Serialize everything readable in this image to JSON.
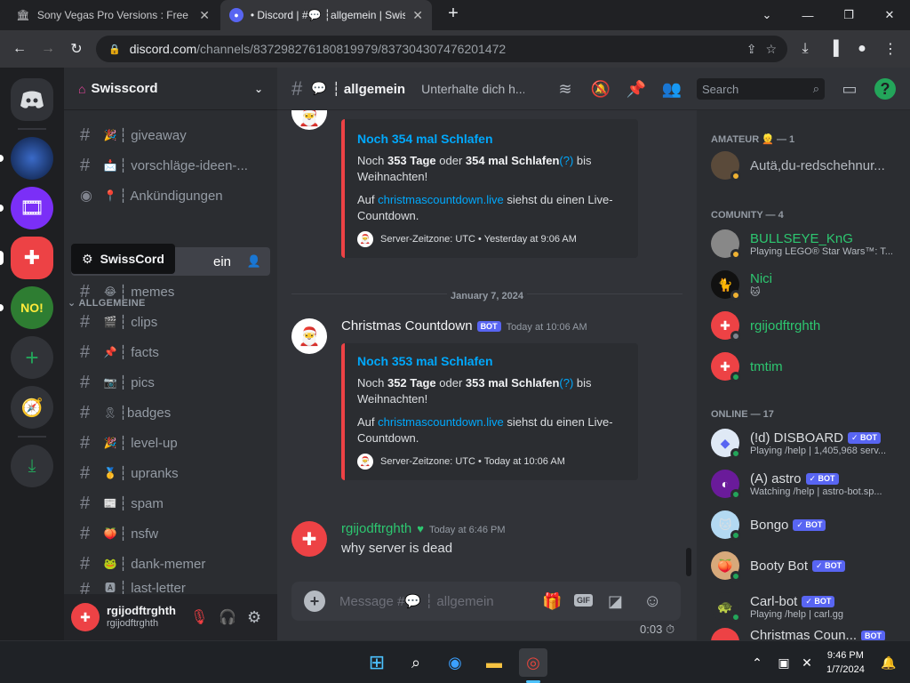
{
  "browser": {
    "tabs": [
      {
        "title": "Sony Vegas Pro Versions : Free D",
        "close": "✕"
      },
      {
        "title": "• Discord | #💬 ┆allgemein | Swis",
        "close": "✕"
      }
    ],
    "new_tab": "+",
    "url_host": "discord.com",
    "url_path": "/channels/837298276180819979/837304307476201472"
  },
  "server": {
    "name": "Swisscord",
    "tooltip": "SwissCord",
    "category": "ALLGEMEINE",
    "channels_top": [
      {
        "emoji": "🎉",
        "label": "┆ giveaway"
      },
      {
        "emoji": "📩",
        "label": "┆ vorschläge-ideen-..."
      },
      {
        "emoji": "📍",
        "label": "┆ Ankündigungen"
      }
    ],
    "selected_channel_label": "ein",
    "channels": [
      {
        "emoji": "😂",
        "label": "┆ memes"
      },
      {
        "emoji": "🎬",
        "label": "┆ clips"
      },
      {
        "emoji": "📌",
        "label": "┆ facts"
      },
      {
        "emoji": "📷",
        "label": "┆ pics"
      },
      {
        "emoji": "🎗",
        "label": "┆badges"
      },
      {
        "emoji": "🎉",
        "label": "┆ level-up"
      },
      {
        "emoji": "🥇",
        "label": "┆ upranks"
      },
      {
        "emoji": "📰",
        "label": "┆ spam"
      },
      {
        "emoji": "🍑",
        "label": "┆ nsfw"
      },
      {
        "emoji": "🐸",
        "label": "┆ dank-memer"
      },
      {
        "emoji": "🅰",
        "label": "┆ last-letter"
      }
    ]
  },
  "user": {
    "display": "rgijodftrghth",
    "username": "rgijodftrghth"
  },
  "chat": {
    "channel": "┆ allgemein",
    "topic": "Unterhalte dich h...",
    "search_placeholder": "Search",
    "embed1": {
      "title": "Noch 354 mal Schlafen",
      "line_pre": "Noch ",
      "days": "353 Tage",
      "mid": " oder ",
      "sleeps": "354 mal Schlafen",
      "q": "(?)",
      "post": " bis Weihnachten!",
      "auf": "Auf ",
      "link": "christmascountdown.live",
      "rest": " siehst du einen Live-Countdown.",
      "footer": "Server-Zeitzone: UTC • Yesterday at 9:06 AM"
    },
    "date_divider": "January 7, 2024",
    "msg2": {
      "author": "Christmas Countdown",
      "bot": "BOT",
      "time": "Today at 10:06 AM"
    },
    "embed2": {
      "title": "Noch 353 mal Schlafen",
      "line_pre": "Noch ",
      "days": "352 Tage",
      "mid": " oder ",
      "sleeps": "353 mal Schlafen",
      "q": "(?)",
      "post": " bis Weihnachten!",
      "auf": "Auf ",
      "link": "christmascountdown.live",
      "rest": " siehst du einen Live-Countdown.",
      "footer": "Server-Zeitzone: UTC • Today at 10:06 AM"
    },
    "msg3": {
      "author": "rgijodftrghth",
      "time": "Today at 6:46 PM",
      "text": "why server is dead"
    },
    "composer_placeholder": "Message #💬 ┆ allgemein",
    "timer": "0:03"
  },
  "members": {
    "cat_amateur": "AMATEUR 👱 — 1",
    "cat_comunity": "COMUNITY — 4",
    "cat_online": "ONLINE — 17",
    "list": [
      {
        "name": "Autä,du-redschehnur...",
        "status": "",
        "color": "#b5bac1",
        "bot": ""
      },
      {
        "name": "BULLSEYE_KnG",
        "status": "Playing LEGO® Star Wars™: T...",
        "color": "#2dc770",
        "bot": ""
      },
      {
        "name": "Nici",
        "status": "🐱",
        "color": "#2dc770",
        "bot": ""
      },
      {
        "name": "rgijodftrghth",
        "status": "",
        "color": "#2dc770",
        "bot": ""
      },
      {
        "name": "tmtim",
        "status": "",
        "color": "#2dc770",
        "bot": ""
      },
      {
        "name": "(!d) DISBOARD",
        "status": "Playing /help | 1,405,968 serv...",
        "color": "#f2f3f5",
        "bot": "✓ BOT"
      },
      {
        "name": "(A) astro",
        "status": "Watching /help | astro-bot.sp...",
        "color": "#f2f3f5",
        "bot": "✓ BOT"
      },
      {
        "name": "Bongo",
        "status": "",
        "color": "#f2f3f5",
        "bot": "✓ BOT"
      },
      {
        "name": "Booty Bot",
        "status": "",
        "color": "#f2f3f5",
        "bot": "✓ BOT"
      },
      {
        "name": "Carl-bot",
        "status": "Playing /help | carl.gg",
        "color": "#f2f3f5",
        "bot": "✓ BOT"
      },
      {
        "name": "Christmas Coun...",
        "status": "",
        "color": "#f2f3f5",
        "bot": "BOT"
      }
    ]
  },
  "taskbar": {
    "time": "9:46 PM",
    "date": "1/7/2024"
  },
  "colors": {
    "blurple": "#5865f2",
    "red": "#ed4245",
    "green": "#23a55a"
  }
}
